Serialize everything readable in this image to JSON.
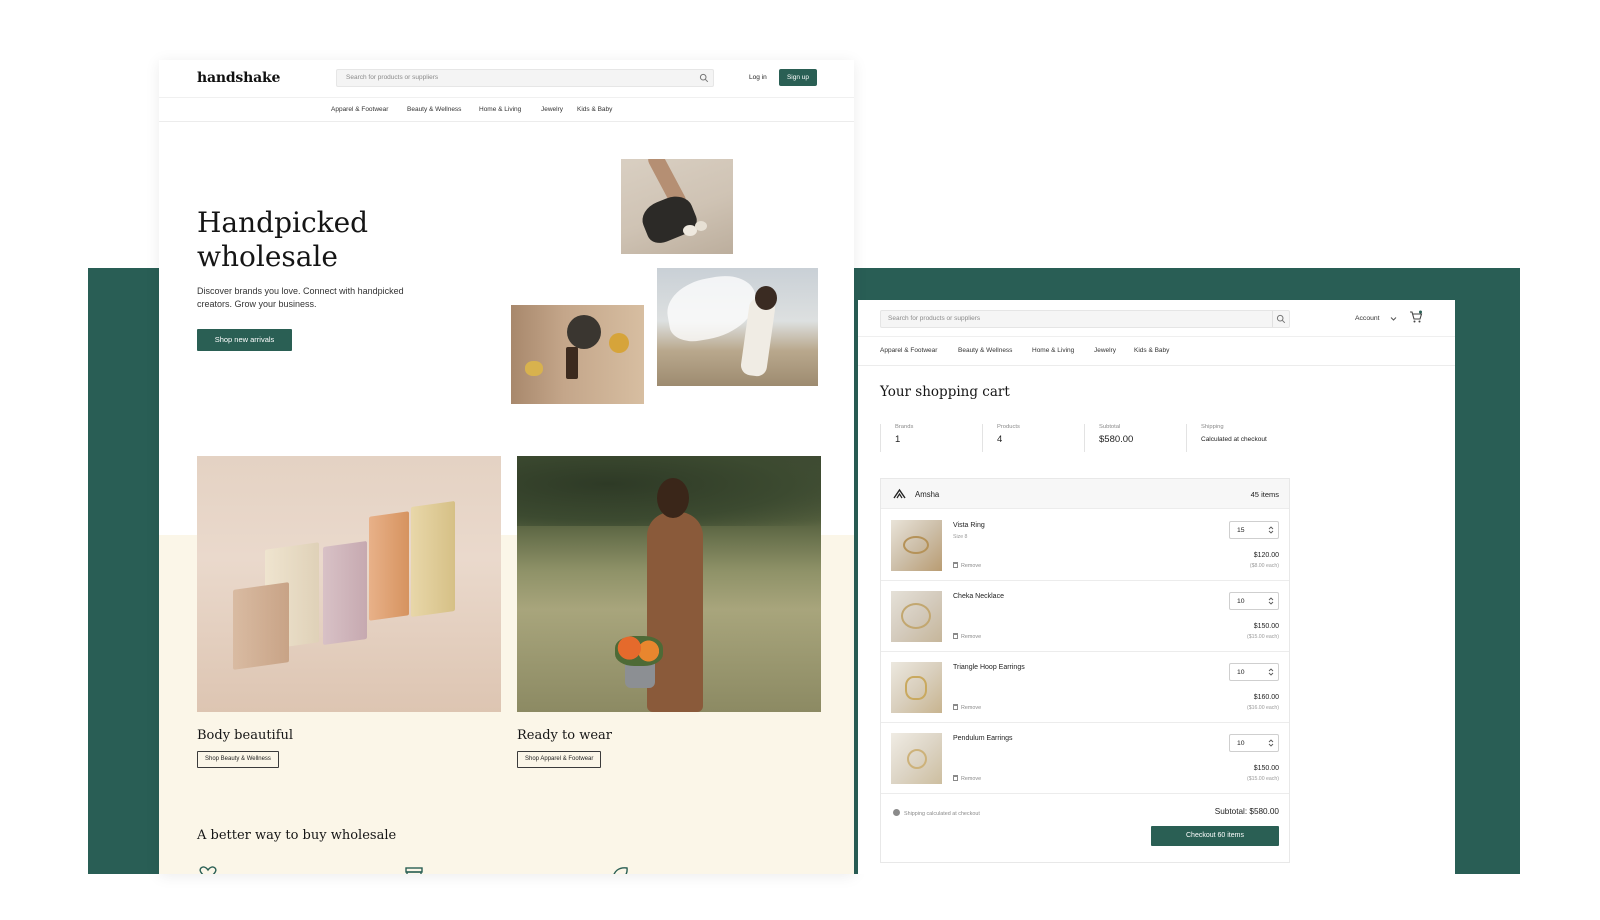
{
  "colors": {
    "brand_green": "#2a5f54",
    "backdrop_green": "#295e55",
    "cream": "#fbf6e8"
  },
  "landing": {
    "logo": "handshake",
    "search_placeholder": "Search for products or suppliers",
    "login": "Log in",
    "signup": "Sign up",
    "nav": [
      "Apparel & Footwear",
      "Beauty & Wellness",
      "Home & Living",
      "Jewelry",
      "Kids & Baby"
    ],
    "hero": {
      "title_line1": "Handpicked",
      "title_line2": "wholesale",
      "subtitle": "Discover brands you love. Connect with handpicked creators. Grow your business.",
      "button": "Shop new arrivals"
    },
    "cards": [
      {
        "title": "Body beautiful",
        "button": "Shop Beauty & Wellness"
      },
      {
        "title": "Ready to wear",
        "button": "Shop Apparel & Footwear"
      }
    ],
    "section_title": "A better way to buy wholesale",
    "feature_icons": [
      "heart-icon",
      "storefront-icon",
      "leaf-icon"
    ]
  },
  "cart": {
    "search_placeholder": "Search for products or suppliers",
    "account": "Account",
    "nav": [
      "Apparel & Footwear",
      "Beauty & Wellness",
      "Home & Living",
      "Jewelry",
      "Kids & Baby"
    ],
    "title": "Your shopping cart",
    "stats": [
      {
        "label": "Brands",
        "value": "1"
      },
      {
        "label": "Products",
        "value": "4"
      },
      {
        "label": "Subtotal",
        "value": "$580.00"
      },
      {
        "label": "Shipping",
        "value": "Calculated at checkout"
      }
    ],
    "brand": {
      "name": "Amsha",
      "count": "45 items"
    },
    "items": [
      {
        "name": "Vista Ring",
        "size": "Size 8",
        "remove": "Remove",
        "qty": "15",
        "price": "$120.00",
        "each": "($8.00 each)"
      },
      {
        "name": "Cheka Necklace",
        "size": "",
        "remove": "Remove",
        "qty": "10",
        "price": "$150.00",
        "each": "($15.00 each)"
      },
      {
        "name": "Triangle Hoop Earrings",
        "size": "",
        "remove": "Remove",
        "qty": "10",
        "price": "$160.00",
        "each": "($16.00 each)"
      },
      {
        "name": "Pendulum Earrings",
        "size": "",
        "remove": "Remove",
        "qty": "10",
        "price": "$150.00",
        "each": "($15.00 each)"
      }
    ],
    "shipping_note": "Shipping calculated at checkout",
    "subtotal": "Subtotal: $580.00",
    "checkout": "Checkout 60 items"
  }
}
